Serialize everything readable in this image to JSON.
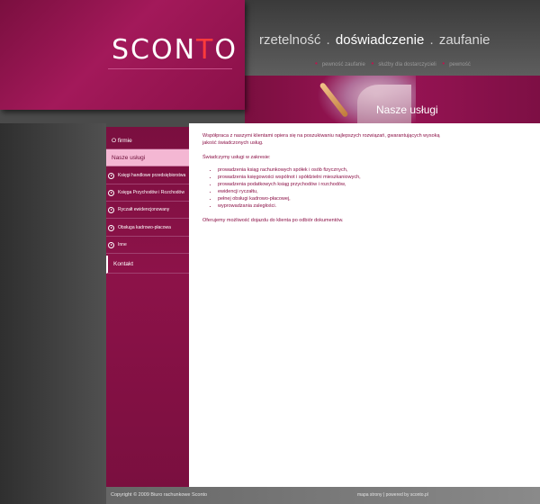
{
  "brand": {
    "logo_part1": "SCON",
    "logo_part2": "T",
    "logo_part3": "O",
    "accent_color": "#ff3b3b",
    "primary_color": "#8d1249"
  },
  "slogan": {
    "word1": "rzetelność",
    "sep1": ".",
    "word2": "doświadczenie",
    "sep2": ".",
    "word3": "zaufanie"
  },
  "tagline": {
    "item1": "pewność zaufanie",
    "item2": "służby dla dostarczycieli",
    "item3": "pewność"
  },
  "banner": {
    "section_title": "Nasze usługi"
  },
  "nav": {
    "items": [
      {
        "label": "O firmie"
      },
      {
        "label": "Nasze usługi"
      },
      {
        "label": "Księgi handlowe przedsiębiorstwa"
      },
      {
        "label": "Księga Przychodów i Rozchodów"
      },
      {
        "label": "Ryczałt ewidencjonowany"
      },
      {
        "label": "Obsługa kadrowo-płacowa"
      },
      {
        "label": "Inne"
      },
      {
        "label": "Kontakt"
      }
    ]
  },
  "content": {
    "intro": "Współpraca z naszymi klientami opiera się na poszukiwaniu najlepszych rozwiązań, gwarantujących wysoką jakość świadczonych usług.",
    "services_heading": "Świadczymy usługi w zakresie:",
    "services": [
      "prowadzenia ksiąg rachunkowych spółek i osób fizycznych,",
      "prowadzenia księgowości wspólnot i spółdzielni mieszkaniowych,",
      "prowadzenia podatkowych ksiąg przychodów i rozchodów,",
      "ewidencji ryczałtu,",
      "pełnej obsługi kadrowo-płacowej,",
      "wyprowadzania zaległości."
    ],
    "offer": "Oferujemy możliwość dojazdu do klienta po odbiór dokumentów."
  },
  "footer": {
    "copyright": "Copyright © 2009 Biuro rachunkowe Sconto",
    "sitemap": "mapa strony",
    "divider": "|",
    "powered": "powered by sconto.pl"
  }
}
